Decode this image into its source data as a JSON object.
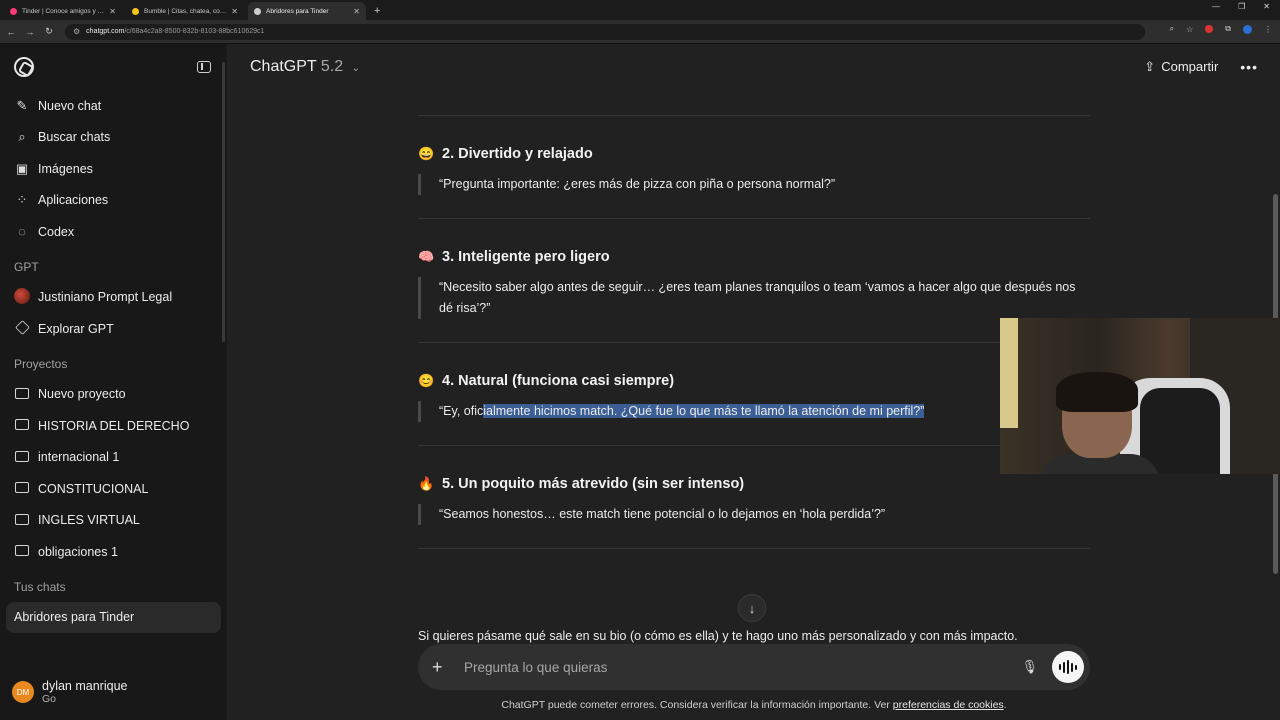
{
  "browser": {
    "tabs": [
      {
        "title": "Tinder | Conoce amigos y gente",
        "favicon_color": "#fd3a73",
        "active": false
      },
      {
        "title": "Bumble | Citas, chatea, conoce",
        "favicon_color": "#f5c518",
        "active": false
      },
      {
        "title": "Abridores para Tinder",
        "favicon_color": "#cfcfcf",
        "active": true
      }
    ],
    "url_host": "chatgpt.com",
    "url_path": "/c/68a4c2a8-8500-832b-8103-88bc610629c1"
  },
  "sidebar": {
    "actions": [
      {
        "label": "Nuevo chat",
        "icon": "new-chat-icon"
      },
      {
        "label": "Buscar chats",
        "icon": "search-icon"
      },
      {
        "label": "Imágenes",
        "icon": "images-icon"
      },
      {
        "label": "Aplicaciones",
        "icon": "apps-icon"
      },
      {
        "label": "Codex",
        "icon": "codex-icon"
      }
    ],
    "gpt_heading": "GPT",
    "gpts": [
      {
        "label": "Justiniano Prompt Legal",
        "icon": "gpt-avatar-icon"
      },
      {
        "label": "Explorar GPT",
        "icon": "explore-icon"
      }
    ],
    "projects_heading": "Proyectos",
    "projects": [
      {
        "label": "Nuevo proyecto"
      },
      {
        "label": "HISTORIA DEL DERECHO"
      },
      {
        "label": "internacional 1"
      },
      {
        "label": "CONSTITUCIONAL"
      },
      {
        "label": "INGLES VIRTUAL"
      },
      {
        "label": "obligaciones 1"
      }
    ],
    "chats_heading": "Tus chats",
    "chats": [
      {
        "label": "Abridores para Tinder",
        "active": true
      }
    ],
    "user": {
      "initials": "DM",
      "name": "dylan manrique",
      "plan": "Go"
    }
  },
  "topbar": {
    "model": "ChatGPT",
    "version": "5.2",
    "share_label": "Compartir"
  },
  "sections": [
    {
      "emoji": "😄",
      "title": "2. Divertido y relajado",
      "quote": "“Pregunta importante: ¿eres más de pizza con piña o persona normal?”"
    },
    {
      "emoji": "🧠",
      "title": "3. Inteligente pero ligero",
      "quote": "“Necesito saber algo antes de seguir… ¿eres team planes tranquilos o team ‘vamos a hacer algo que después nos dé risa’?”"
    },
    {
      "emoji": "😊",
      "title": "4. Natural (funciona casi siempre)",
      "quote_pre": "“Ey, ofic",
      "quote_hl": "ialmente hicimos match. ¿Qué fue lo que más te llamó la atención de mi perfil?”"
    },
    {
      "emoji": "🔥",
      "title": "5. Un poquito más atrevido (sin ser intenso)",
      "quote": "“Seamos honestos… este match tiene potencial o lo dejamos en ‘hola perdida’?”"
    }
  ],
  "continuation": "Si quieres pásame qué sale en su bio (o cómo es ella) y te hago uno más personalizado y con más impacto.",
  "composer": {
    "placeholder": "Pregunta lo que quieras"
  },
  "footer": {
    "text": "ChatGPT puede cometer errores. Considera verificar la información importante. Ver ",
    "link": "preferencias de cookies",
    "end": "."
  }
}
